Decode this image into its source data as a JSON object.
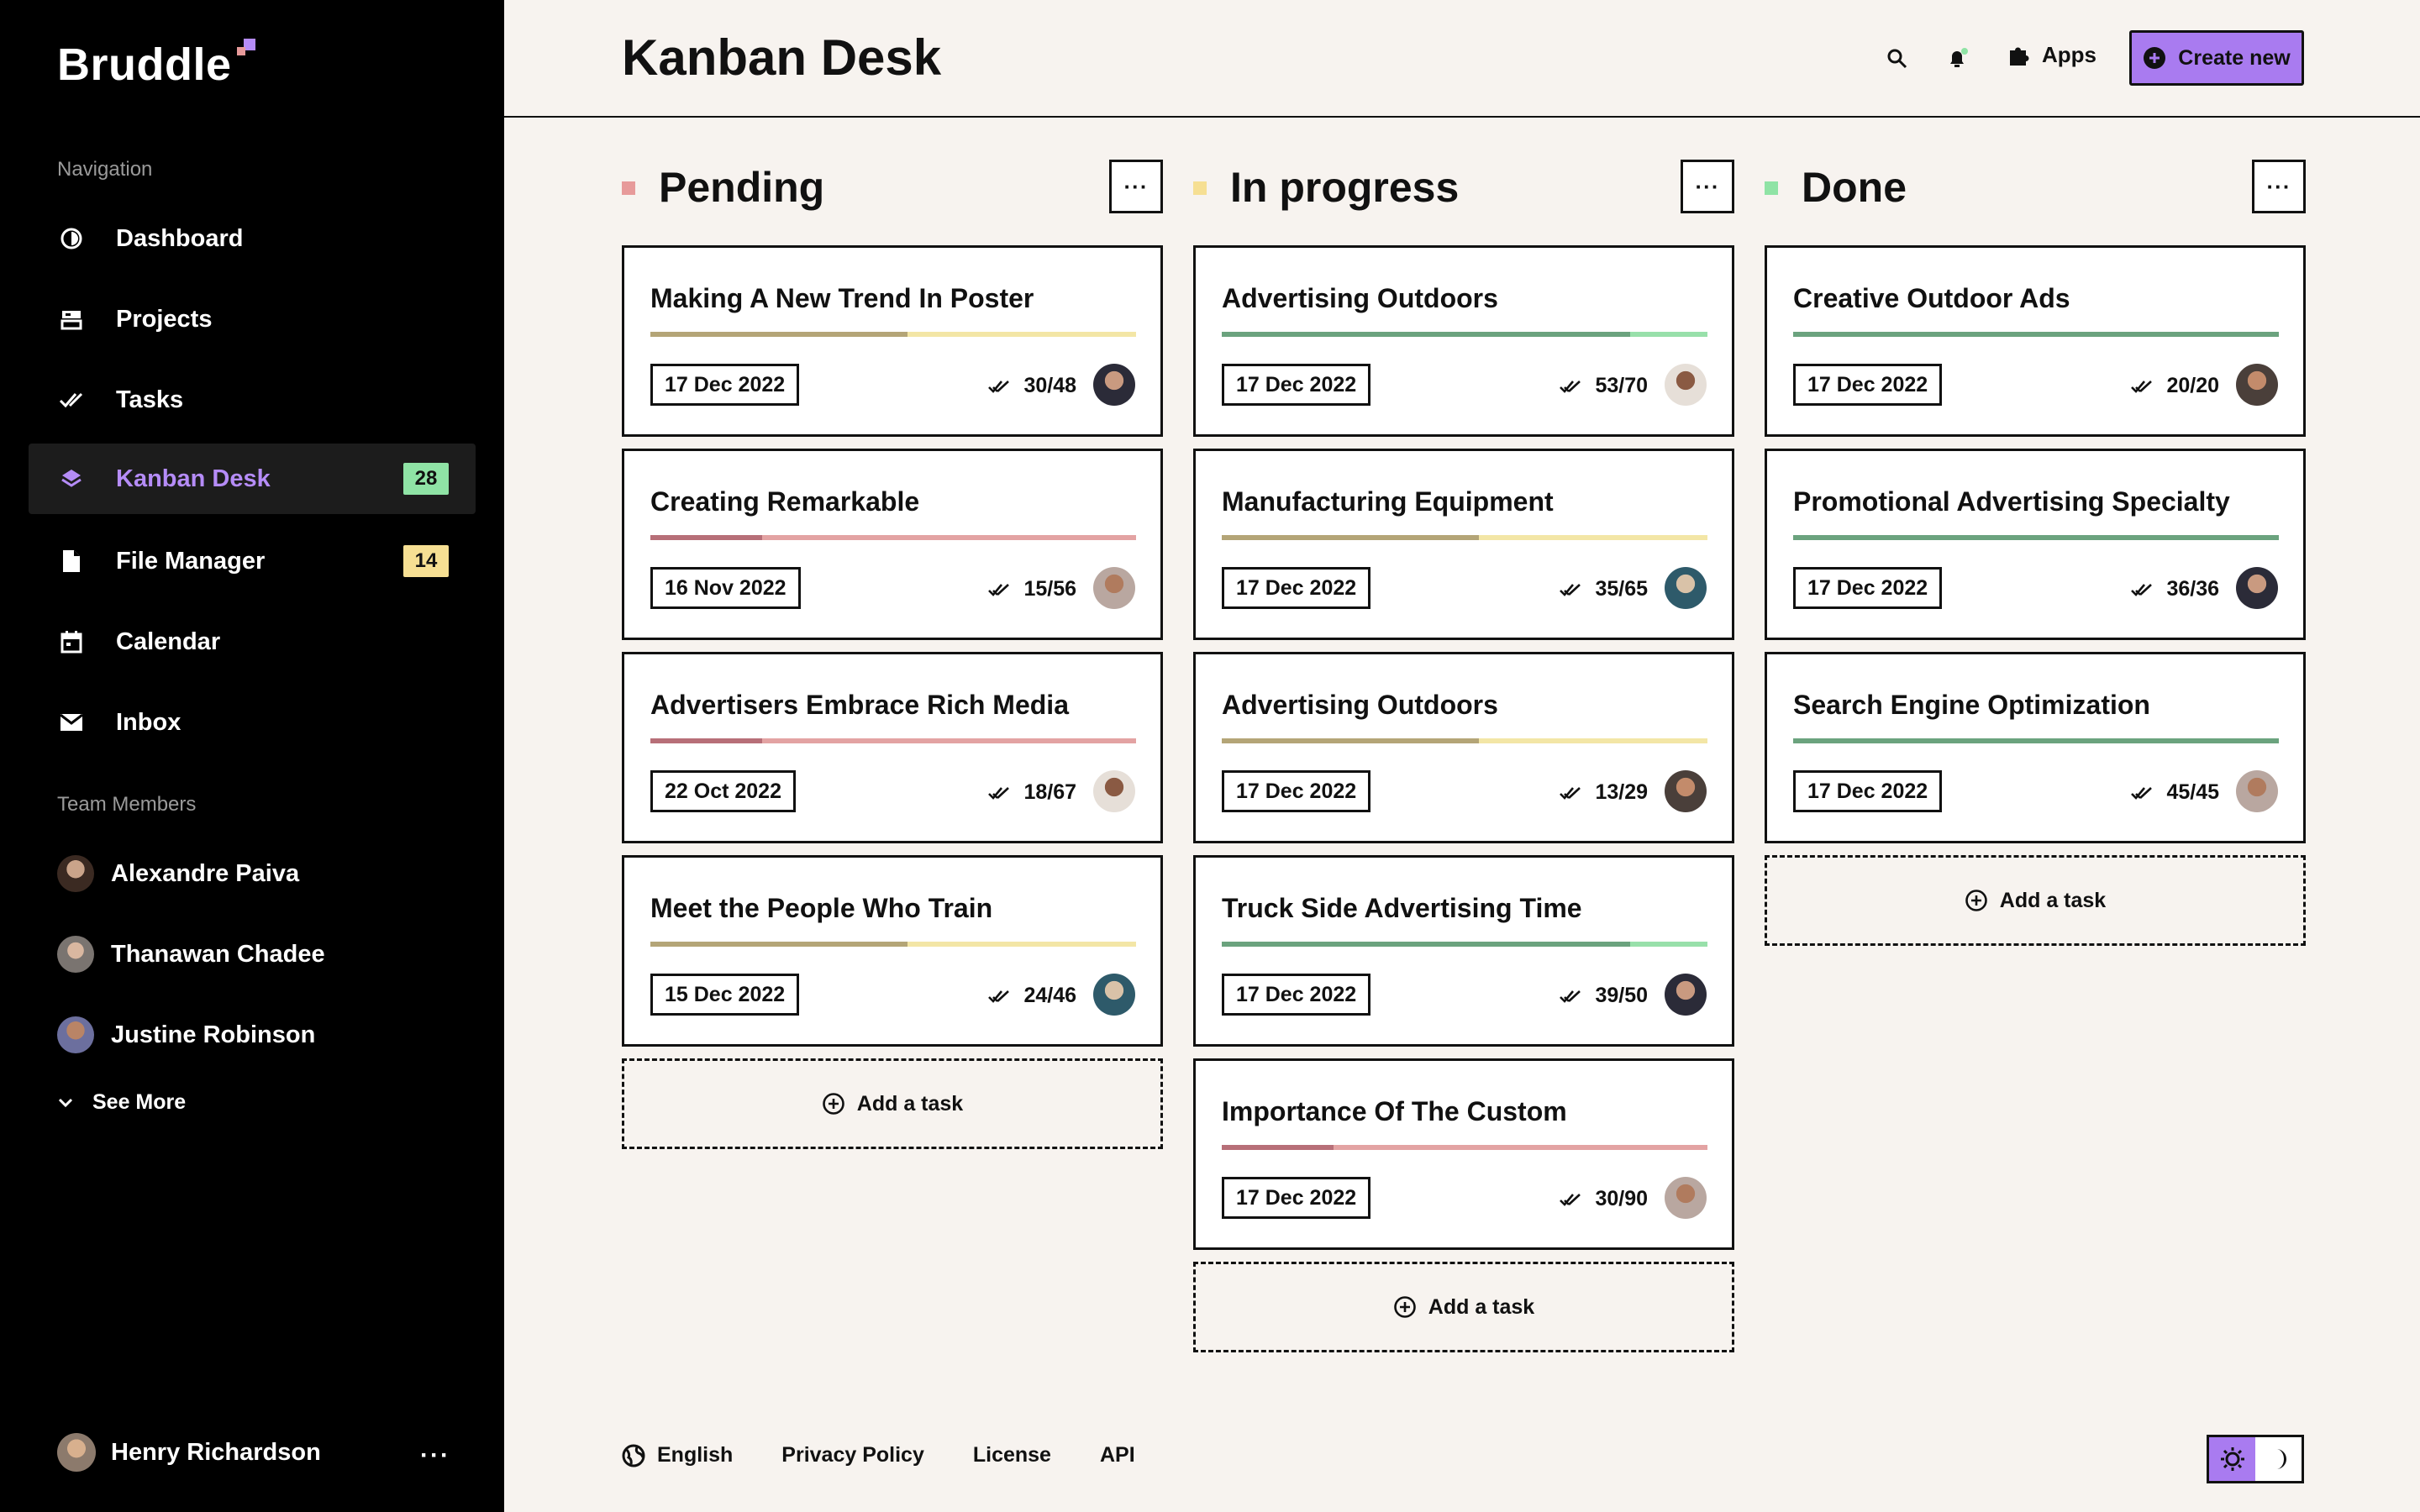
{
  "app": {
    "name": "Bruddle"
  },
  "sidebar": {
    "nav_label": "Navigation",
    "items": [
      {
        "label": "Dashboard",
        "icon": "dashboard-icon"
      },
      {
        "label": "Projects",
        "icon": "projects-icon"
      },
      {
        "label": "Tasks",
        "icon": "tasks-icon"
      },
      {
        "label": "Kanban Desk",
        "icon": "kanban-icon",
        "badge": "28",
        "badge_color": "#8fe3a5",
        "active": true
      },
      {
        "label": "File Manager",
        "icon": "file-icon",
        "badge": "14",
        "badge_color": "#f6df93"
      },
      {
        "label": "Calendar",
        "icon": "calendar-icon"
      },
      {
        "label": "Inbox",
        "icon": "inbox-icon"
      }
    ],
    "team_label": "Team Members",
    "members": [
      {
        "name": "Alexandre Paiva"
      },
      {
        "name": "Thanawan Chadee"
      },
      {
        "name": "Justine Robinson"
      }
    ],
    "see_more": "See More",
    "user": {
      "name": "Henry Richardson",
      "more": "···"
    }
  },
  "header": {
    "title": "Kanban Desk",
    "apps_label": "Apps",
    "create_label": "Create new"
  },
  "columns": [
    {
      "title": "Pending",
      "dot_color": "#e79a9a",
      "add_label": "Add a task",
      "cards": [
        {
          "title": "Making A New Trend In Poster",
          "date": "17 Dec 2022",
          "count": "30/48",
          "progress": 0.53,
          "done_color": "#b4a577",
          "rest_color": "#f3e6a6"
        },
        {
          "title": "Creating Remarkable",
          "date": "16 Nov 2022",
          "count": "15/56",
          "progress": 0.23,
          "done_color": "#b76f78",
          "rest_color": "#e3a3a3"
        },
        {
          "title": "Advertisers Embrace Rich Media",
          "date": "22 Oct 2022",
          "count": "18/67",
          "progress": 0.23,
          "done_color": "#b76f78",
          "rest_color": "#e3a3a3"
        },
        {
          "title": "Meet the People Who Train",
          "date": "15 Dec 2022",
          "count": "24/46",
          "progress": 0.53,
          "done_color": "#b4a577",
          "rest_color": "#f3e6a6"
        }
      ]
    },
    {
      "title": "In progress",
      "dot_color": "#f6df93",
      "add_label": "Add a task",
      "cards": [
        {
          "title": "Advertising Outdoors",
          "date": "17 Dec 2022",
          "count": "53/70",
          "progress": 0.84,
          "done_color": "#6ba37e",
          "rest_color": "#98e0aa"
        },
        {
          "title": "Manufacturing Equipment",
          "date": "17 Dec 2022",
          "count": "35/65",
          "progress": 0.53,
          "done_color": "#b4a577",
          "rest_color": "#f3e6a6"
        },
        {
          "title": "Advertising Outdoors",
          "date": "17 Dec 2022",
          "count": "13/29",
          "progress": 0.53,
          "done_color": "#b4a577",
          "rest_color": "#f3e6a6"
        },
        {
          "title": "Truck Side Advertising Time",
          "date": "17 Dec 2022",
          "count": "39/50",
          "progress": 0.84,
          "done_color": "#6ba37e",
          "rest_color": "#98e0aa"
        },
        {
          "title": "Importance Of The Custom",
          "date": "17 Dec 2022",
          "count": "30/90",
          "progress": 0.23,
          "done_color": "#b76f78",
          "rest_color": "#e3a3a3"
        }
      ]
    },
    {
      "title": "Done",
      "dot_color": "#8fe3a5",
      "add_label": "Add a task",
      "cards": [
        {
          "title": "Creative Outdoor Ads",
          "date": "17 Dec 2022",
          "count": "20/20",
          "progress": 1,
          "done_color": "#6ba37e",
          "rest_color": "#98e0aa"
        },
        {
          "title": "Promotional Advertising Specialty",
          "date": "17 Dec 2022",
          "count": "36/36",
          "progress": 1,
          "done_color": "#6ba37e",
          "rest_color": "#98e0aa"
        },
        {
          "title": "Search Engine Optimization",
          "date": "17 Dec 2022",
          "count": "45/45",
          "progress": 1,
          "done_color": "#6ba37e",
          "rest_color": "#98e0aa"
        }
      ]
    }
  ],
  "footer": {
    "language": "English",
    "links": [
      "Privacy Policy",
      "License",
      "API"
    ]
  },
  "colors": {
    "accent": "#a97bf0",
    "green": "#8fe3a5",
    "yellow": "#f6df93",
    "pink": "#e79a9a"
  }
}
